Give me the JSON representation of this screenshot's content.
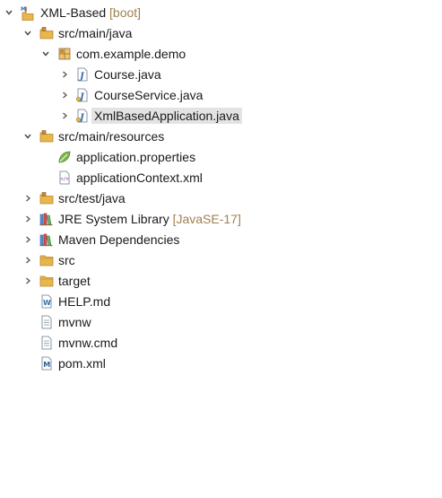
{
  "explorer": {
    "project": {
      "name": "XML-Based",
      "decoration": "[boot]"
    },
    "src_main_java": "src/main/java",
    "package": "com.example.demo",
    "course_java": "Course.java",
    "course_service_java": "CourseService.java",
    "xml_based_application_java": "XmlBasedApplication.java",
    "src_main_resources": "src/main/resources",
    "application_properties": "application.properties",
    "application_context_xml": "applicationContext.xml",
    "src_test_java": "src/test/java",
    "jre_library": {
      "name": "JRE System Library",
      "decoration": "[JavaSE-17]"
    },
    "maven_dependencies": "Maven Dependencies",
    "src_folder": "src",
    "target_folder": "target",
    "help_md": "HELP.md",
    "mvnw": "mvnw",
    "mvnw_cmd": "mvnw.cmd",
    "pom_xml": "pom.xml",
    "selected_item": "XmlBasedApplication.java"
  },
  "colors": {
    "selection": "#e3e3e3",
    "decoration_text": "#a08050",
    "folder": "#e8b64a",
    "java_file": "#3a6fb0",
    "library": "#8a6d3b"
  }
}
